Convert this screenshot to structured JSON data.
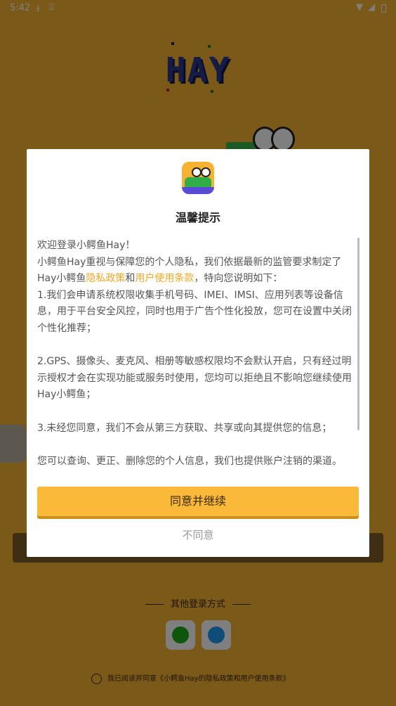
{
  "status_bar": {
    "time": "5:42",
    "icons": [
      "download-icon",
      "accessibility-icon",
      "wifi-icon",
      "signal-icon",
      "battery-icon"
    ]
  },
  "background": {
    "logo": "HAY",
    "other_login": "其他登录方式",
    "social_icons": [
      "wechat-icon",
      "qq-icon"
    ],
    "agreement_text": "我已阅读并同意《小鳄鱼Hay的隐私政策和用户使用条款》"
  },
  "dialog": {
    "title": "温馨提示",
    "intro_line1": "欢迎登录小鳄鱼Hay！",
    "intro_line2a": "小鳄鱼Hay重视与保障您的个人隐私，我们依据最新的监管要求制定了Hay小鳄鱼",
    "privacy_link": "隐私政策",
    "and": "和",
    "terms_link": "用户使用条款",
    "intro_line2b": "，特向您说明如下：",
    "point1": "1.我们会申请系统权限收集手机号码、IMEI、IMSI、应用列表等设备信息，用于平台安全风控，同时也用于广告个性化投放，您可在设置中关闭个性化推荐；",
    "point2": "2.GPS、摄像头、麦克风、相册等敏感权限均不会默认开启，只有经过明示授权才会在实现功能或服务时使用，您均可以拒绝且不影响您继续使用Hay小鳄鱼；",
    "point3": "3.未经您同意，我们不会从第三方获取、共享或向其提供您的信息；",
    "point4": "您可以查询、更正、删除您的个人信息，我们也提供账户注销的渠道。",
    "agree_button": "同意并继续",
    "disagree_button": "不同意"
  },
  "colors": {
    "brand_yellow": "#f7b233",
    "button_yellow": "#fbb93a",
    "link_orange": "#f5a623"
  }
}
